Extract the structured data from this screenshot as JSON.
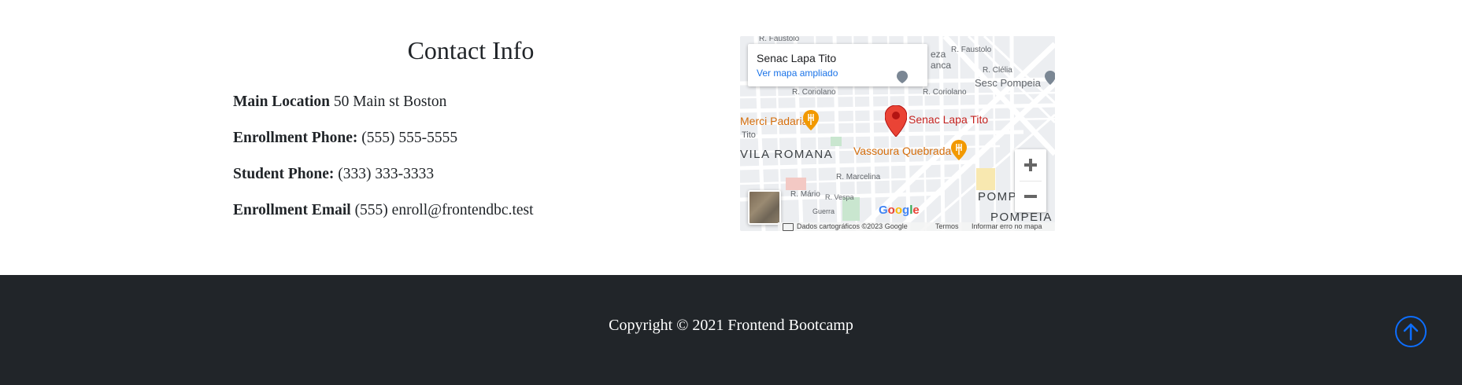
{
  "contact": {
    "title": "Contact Info",
    "lines": [
      {
        "label": "Main Location",
        "value": " 50 Main st Boston"
      },
      {
        "label": "Enrollment Phone:",
        "value": " (555) 555-5555"
      },
      {
        "label": "Student Phone:",
        "value": " (333) 333-3333"
      },
      {
        "label": "Enrollment Email",
        "value": " (555) enroll@frontendbc.test"
      }
    ]
  },
  "map": {
    "place_name": "Senac Lapa Tito",
    "link": "Ver mapa ampliado",
    "marker_label": "Senac Lapa Tito",
    "labels": {
      "faustolo": "R. Faustolo",
      "eza": "eza",
      "anca": "anca",
      "clelia": "R. Clélia",
      "sesc": "Sesc Pompeia",
      "coriolano1": "R. Coriolano",
      "coriolano2": "R. Coriolano",
      "merci": "Merci Padaria",
      "tito": "Tito",
      "vila_romana": "VILA ROMANA",
      "vassoura": "Vassoura Quebrada",
      "marcelina": "R. Marcelina",
      "mario": "R. Mário",
      "guerra": "Guerra",
      "vespa": "R. Vespa",
      "pomp": "POMP",
      "pompeia": "POMPEIA",
      "google": "Google"
    },
    "attribution": {
      "data": "Dados cartográficos ©2023 Google",
      "terms": "Termos",
      "report": "Informar erro no mapa"
    },
    "colors": {
      "marker": "#ea4335",
      "poi": "#f29900",
      "link": "#1a73e8"
    }
  },
  "footer": {
    "copyright": "Copyright © 2021 Frontend Bootcamp",
    "to_top_icon": "arrow-up-circle-icon",
    "accent": "#0d6efd"
  }
}
